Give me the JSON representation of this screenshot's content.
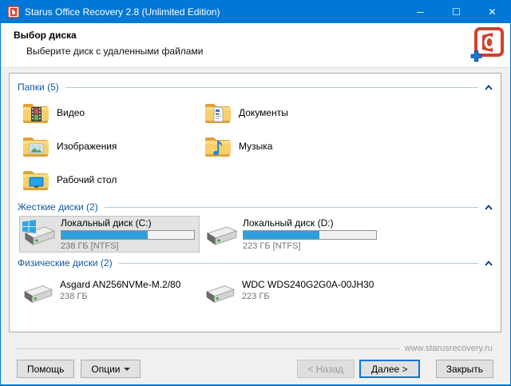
{
  "window": {
    "title": "Starus Office Recovery 2.8 (Unlimited Edition)",
    "controls": {
      "minimize": "─",
      "maximize": "☐",
      "close": "✕"
    }
  },
  "header": {
    "title": "Выбор диска",
    "subtitle": "Выберите диск с удаленными файлами",
    "logo_icon": "office-recovery-logo"
  },
  "sections": {
    "folders": {
      "label": "Папки (5)",
      "items": [
        {
          "label": "Видео",
          "icon": "video-folder-icon"
        },
        {
          "label": "Документы",
          "icon": "documents-folder-icon"
        },
        {
          "label": "Изображения",
          "icon": "pictures-folder-icon"
        },
        {
          "label": "Музыка",
          "icon": "music-folder-icon"
        },
        {
          "label": "Рабочий стол",
          "icon": "desktop-folder-icon"
        }
      ]
    },
    "hard_disks": {
      "label": "Жесткие диски (2)",
      "items": [
        {
          "name": "Локальный диск (C:)",
          "size": "238 ГБ [NTFS]",
          "used_percent": 65,
          "selected": true,
          "icon": "system-drive-icon"
        },
        {
          "name": "Локальный диск (D:)",
          "size": "223 ГБ [NTFS]",
          "used_percent": 57,
          "selected": false,
          "icon": "drive-icon"
        }
      ]
    },
    "physical_disks": {
      "label": "Физические диски (2)",
      "items": [
        {
          "name": "Asgard AN256NVMe-M.2/80",
          "size": "238 ГБ",
          "icon": "drive-icon"
        },
        {
          "name": "WDC WDS240G2G0A-00JH30",
          "size": "223 ГБ",
          "icon": "drive-icon"
        }
      ]
    }
  },
  "footer": {
    "website": "www.starusrecovery.ru",
    "buttons": {
      "help": "Помощь",
      "options": "Опции",
      "back": "< Назад",
      "next": "Далее >",
      "close": "Закрыть"
    }
  },
  "colors": {
    "accent": "#0078d7",
    "progress_fill": "#2f9fdc",
    "section_header_text": "#1158a8",
    "selected_item_bg": "#e3e3e3"
  }
}
